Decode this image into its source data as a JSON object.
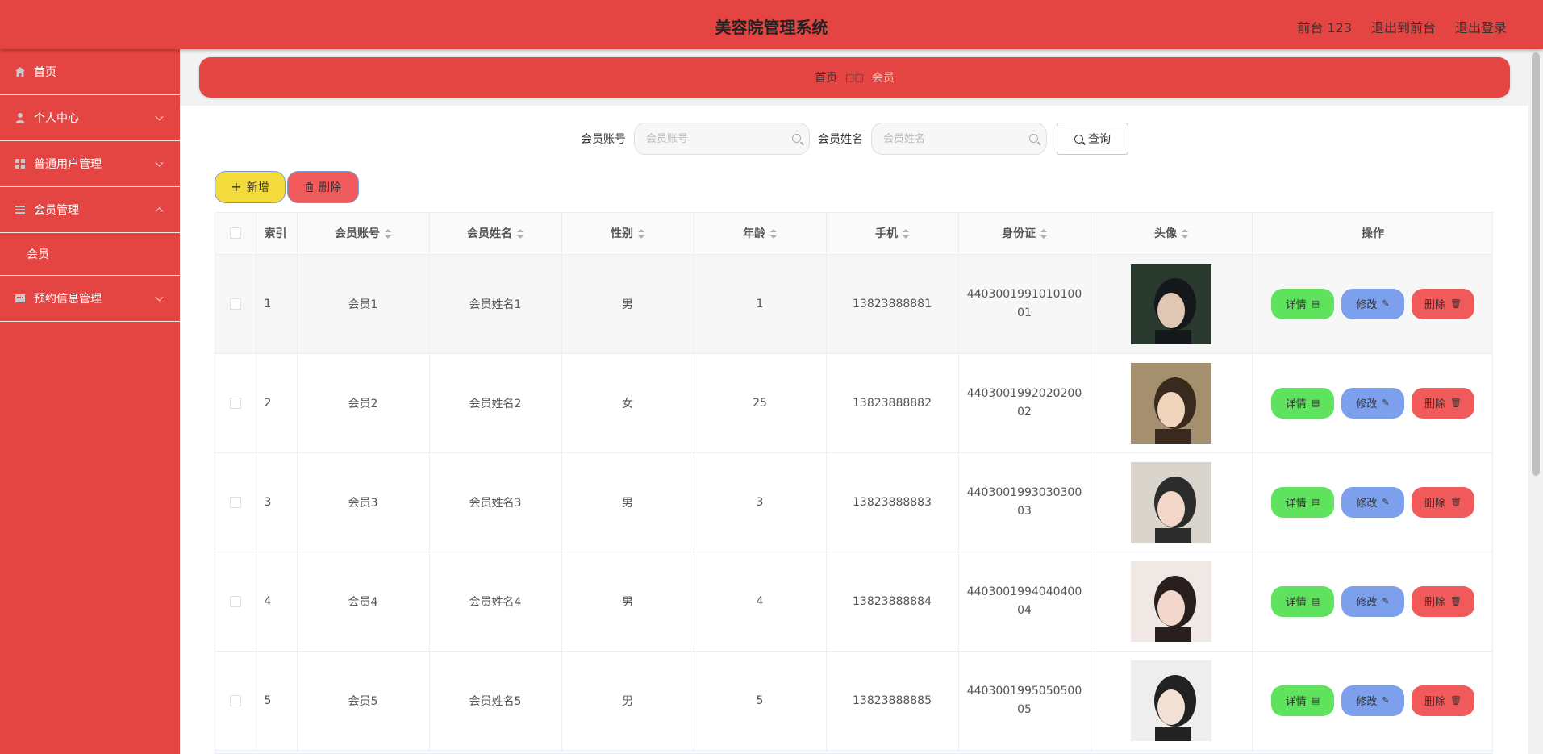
{
  "header": {
    "title": "美容院管理系统",
    "links": [
      "前台 123",
      "退出到前台",
      "退出登录"
    ]
  },
  "sidebar": {
    "items": [
      {
        "label": "首页",
        "icon": "home-icon"
      },
      {
        "label": "个人中心",
        "icon": "user-icon"
      },
      {
        "label": "普通用户管理",
        "icon": "grid-icon"
      },
      {
        "label": "会员管理",
        "icon": "list-icon",
        "expanded": true,
        "children": [
          {
            "label": "会员"
          }
        ]
      },
      {
        "label": "预约信息管理",
        "icon": "calendar-icon"
      }
    ]
  },
  "breadcrumb": {
    "home": "首页",
    "sep": "□□",
    "current": "会员"
  },
  "search": {
    "account_label": "会员账号",
    "account_placeholder": "会员账号",
    "name_label": "会员姓名",
    "name_placeholder": "会员姓名",
    "query_label": "查询"
  },
  "actions": {
    "add_label": "新增",
    "delete_label": "删除"
  },
  "table": {
    "columns": [
      "索引",
      "会员账号",
      "会员姓名",
      "性别",
      "年龄",
      "手机",
      "身份证",
      "头像",
      "操作"
    ],
    "rows": [
      {
        "index": "1",
        "account": "会员1",
        "name": "会员姓名1",
        "gender": "男",
        "age": "1",
        "phone": "13823888881",
        "idcard": "440300199101010001",
        "avatar": "avatar-1"
      },
      {
        "index": "2",
        "account": "会员2",
        "name": "会员姓名2",
        "gender": "女",
        "age": "25",
        "phone": "13823888882",
        "idcard": "440300199202020002",
        "avatar": "avatar-2"
      },
      {
        "index": "3",
        "account": "会员3",
        "name": "会员姓名3",
        "gender": "男",
        "age": "3",
        "phone": "13823888883",
        "idcard": "440300199303030003",
        "avatar": "avatar-3"
      },
      {
        "index": "4",
        "account": "会员4",
        "name": "会员姓名4",
        "gender": "男",
        "age": "4",
        "phone": "13823888884",
        "idcard": "440300199404040004",
        "avatar": "avatar-4"
      },
      {
        "index": "5",
        "account": "会员5",
        "name": "会员姓名5",
        "gender": "男",
        "age": "5",
        "phone": "13823888885",
        "idcard": "440300199505050005",
        "avatar": "avatar-5"
      }
    ],
    "row_actions": {
      "detail": "详情",
      "edit": "修改",
      "remove": "删除"
    }
  },
  "colors": {
    "primary": "#e44442",
    "add_button": "#f3db3b",
    "delete_button": "#f15a5a",
    "detail_button": "#5fe25d",
    "edit_button": "#7da0ec"
  }
}
